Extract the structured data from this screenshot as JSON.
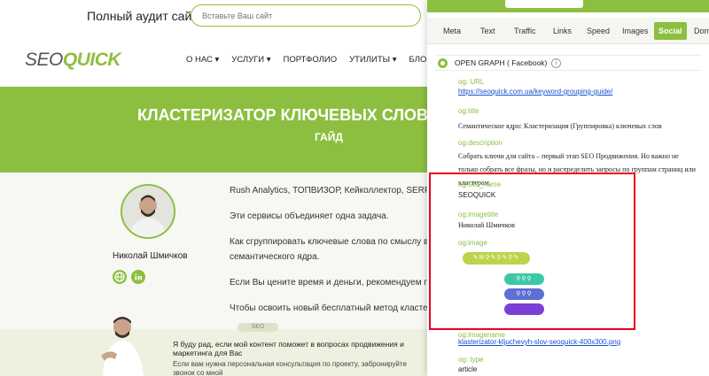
{
  "site": {
    "audit_title": "Полный аудит сайта",
    "search_placeholder": "Вставьте Ваш сайт",
    "logo_seo": "SEO",
    "logo_quick": "QUICK",
    "nav": [
      "О НАС ▾",
      "УСЛУГИ ▾",
      "ПОРТФОЛИО",
      "УТИЛИТЫ ▾",
      "БЛОГ ▾"
    ],
    "hero_title": "КЛАСТЕРИЗАТОР КЛЮЧЕВЫХ СЛОВ",
    "hero_subtitle": "ГАЙД",
    "author_name": "Николай Шмичков",
    "paragraphs": [
      "Rush Analytics, ТОПВИЗОР, Кейколлектор, SERPSTAT",
      "Эти сервисы объединяет одна задача.",
      "Как сгруппировать ключевые слова по смыслу в гр",
      "семантического ядра.",
      "Если Вы цените время и деньги, рекомендуем пот",
      "Чтобы освоить новый бесплатный метод кластерн"
    ],
    "tag_pill": "SEO",
    "promo_title": "Я буду рад, если мой контент поможет в вопросах продвижения и маркетинга для Вас",
    "promo_text": "Если вам нужна персональная консультация по проекту, забронируйте звонок со мной"
  },
  "panel": {
    "tabs": [
      "Meta",
      "Text",
      "Traffic",
      "Links",
      "Speed",
      "Images",
      "Social",
      "Dom"
    ],
    "active_tab": "Social",
    "section_title": "OPEN GRAPH ( Facebook)",
    "info_glyph": "i",
    "fields": {
      "url_label": "og: URL",
      "url_value": "https://seoquick.com.ua/keyword-grouping-guide/",
      "title_label": "og:title",
      "title_value": "Семантическое ядро: Кластеризация (Группировка) ключевых слов",
      "description_label": "og:description",
      "description_value": "Собрать ключи для сайта – первый этап SEO Продвижения. Но важно не только собрать все фразы, но и распределить запросы по группам страниц или кластерам.",
      "site_name_label": "og:site_name",
      "site_name_value": "SEOQUICK",
      "imagetitle_label": "og:imagetitle",
      "imagetitle_value": "Николай Шмичков",
      "image_label": "og:image",
      "imagename_label": "og:imagename",
      "imagename_value": "klasterizator-kljuchevyh-slov-seoquick-400x300.png",
      "type_label": "og: type",
      "type_value": "article"
    }
  },
  "colors": {
    "brand_green": "#8cbf3f",
    "highlight_red": "#e8001c",
    "link_blue": "#1a4fd0"
  }
}
